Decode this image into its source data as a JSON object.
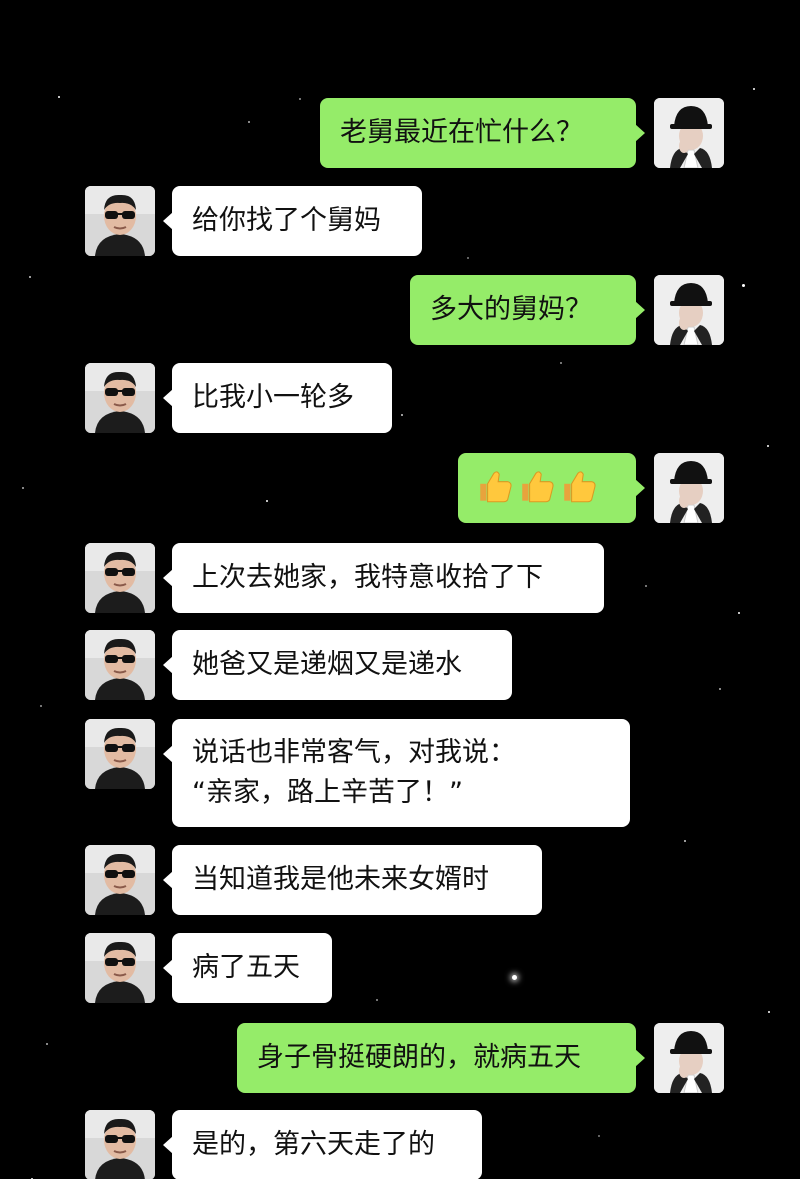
{
  "chat": {
    "messages": [
      {
        "side": "right",
        "text": "老舅最近在忙什么？"
      },
      {
        "side": "left",
        "text": "给你找了个舅妈"
      },
      {
        "side": "right",
        "text": "多大的舅妈？"
      },
      {
        "side": "left",
        "text": "比我小一轮多"
      },
      {
        "side": "right",
        "emoji": "thumbs-up-icon x3"
      },
      {
        "side": "left",
        "text": "上次去她家，我特意收拾了下"
      },
      {
        "side": "left",
        "text": "她爸又是递烟又是递水"
      },
      {
        "side": "left",
        "lines": [
          "说话也非常客气，对我说：",
          "“亲家，路上辛苦了！”"
        ]
      },
      {
        "side": "left",
        "text": "当知道我是他未来女婿时"
      },
      {
        "side": "left",
        "text": "病了五天"
      },
      {
        "side": "right",
        "text": "身子骨挺硬朗的，就病五天"
      },
      {
        "side": "left",
        "text": "是的，第六天走了的"
      }
    ]
  },
  "colors": {
    "background": "#000000",
    "sent_bubble": "#95ec69",
    "received_bubble": "#ffffff"
  },
  "icons": {
    "left_avatar": "avatar-man-sunglasses",
    "right_avatar": "avatar-black-bucket-hat",
    "emoji": "thumbs-up-icon"
  }
}
